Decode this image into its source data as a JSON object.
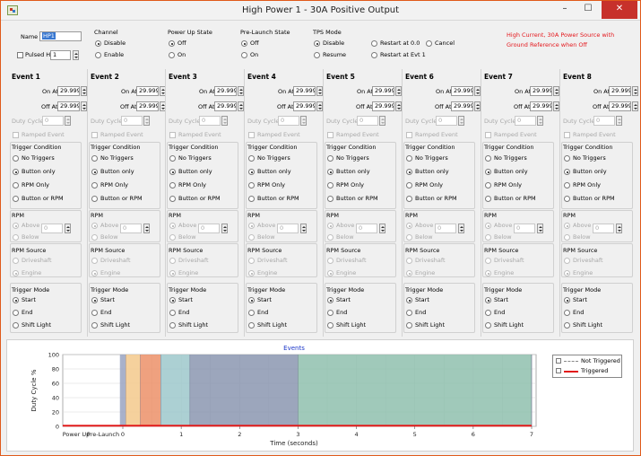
{
  "window": {
    "title": "High Power 1 - 30A Positive Output",
    "minimize": "–",
    "maximize": "☐",
    "close": "✕"
  },
  "header": {
    "name_label": "Name",
    "name_value": "HP1",
    "pulsed_label": "Pulsed Hz",
    "pulsed_value": "1",
    "channel": {
      "title": "Channel",
      "options": [
        "Disable",
        "Enable"
      ],
      "selected": "Disable"
    },
    "power_up": {
      "title": "Power Up State",
      "options": [
        "Off",
        "On"
      ],
      "selected": "Off"
    },
    "pre_launch": {
      "title": "Pre-Launch State",
      "options": [
        "Off",
        "On"
      ],
      "selected": "Off"
    },
    "tps": {
      "title": "TPS Mode",
      "options": [
        "Disable",
        "Restart at 0.0",
        "Cancel",
        "Resume",
        "Restart at Evt 1"
      ],
      "selected": "Disable"
    },
    "warning": "High Current, 30A Power Source with Ground Reference when Off"
  },
  "event_labels": {
    "on_at": "On At",
    "off_at": "Off At",
    "duty_cycle": "Duty Cycle",
    "ramped": "Ramped Event",
    "trigger_condition": "Trigger Condition",
    "trigger_options": [
      "No Triggers",
      "Button only",
      "RPM Only",
      "Button or RPM"
    ],
    "rpm": "RPM",
    "rpm_options": [
      "Above",
      "Below"
    ],
    "rpm_source": "RPM Source",
    "rpm_source_options": [
      "Driveshaft",
      "Engine"
    ],
    "trigger_mode": "Trigger Mode",
    "trigger_mode_options": [
      "Start",
      "End",
      "Shift Light"
    ]
  },
  "events": [
    {
      "title": "Event 1",
      "on_at": "29.999",
      "off_at": "29.999",
      "duty_cycle": "0",
      "rpm": "0",
      "trigger": "Button only",
      "rpm_level": "Above",
      "rpm_source": "Engine",
      "mode": "Start"
    },
    {
      "title": "Event 2",
      "on_at": "29.999",
      "off_at": "29.999",
      "duty_cycle": "0",
      "rpm": "0",
      "trigger": "Button only",
      "rpm_level": "Above",
      "rpm_source": "Engine",
      "mode": "Start"
    },
    {
      "title": "Event 3",
      "on_at": "29.999",
      "off_at": "29.999",
      "duty_cycle": "0",
      "rpm": "0",
      "trigger": "Button only",
      "rpm_level": "Above",
      "rpm_source": "Engine",
      "mode": "Start"
    },
    {
      "title": "Event 4",
      "on_at": "29.999",
      "off_at": "29.999",
      "duty_cycle": "0",
      "rpm": "0",
      "trigger": "Button only",
      "rpm_level": "Above",
      "rpm_source": "Engine",
      "mode": "Start"
    },
    {
      "title": "Event 5",
      "on_at": "29.999",
      "off_at": "29.999",
      "duty_cycle": "0",
      "rpm": "0",
      "trigger": "Button only",
      "rpm_level": "Above",
      "rpm_source": "Engine",
      "mode": "Start"
    },
    {
      "title": "Event 6",
      "on_at": "29.999",
      "off_at": "29.999",
      "duty_cycle": "0",
      "rpm": "0",
      "trigger": "Button only",
      "rpm_level": "Above",
      "rpm_source": "Engine",
      "mode": "Start"
    },
    {
      "title": "Event 7",
      "on_at": "29.999",
      "off_at": "29.999",
      "duty_cycle": "0",
      "rpm": "0",
      "trigger": "Button only",
      "rpm_level": "Above",
      "rpm_source": "Engine",
      "mode": "Start"
    },
    {
      "title": "Event 8",
      "on_at": "29.999",
      "off_at": "29.999",
      "duty_cycle": "0",
      "rpm": "0",
      "trigger": "Button only",
      "rpm_level": "Above",
      "rpm_source": "Engine",
      "mode": "Start"
    }
  ],
  "chart_data": {
    "type": "area",
    "title": "Events",
    "xlabel": "Time (seconds)",
    "ylabel": "Duty Cycle %",
    "xlim": [
      0,
      7
    ],
    "ylim": [
      0,
      100
    ],
    "x_ticks": [
      "0",
      "1",
      "2",
      "3",
      "4",
      "5",
      "6",
      "7"
    ],
    "y_ticks": [
      "0",
      "20",
      "40",
      "60",
      "80",
      "100"
    ],
    "extra_x_labels": [
      "Power Up",
      "Pre-Launch"
    ],
    "grid": true,
    "legend_position": "top-right",
    "bands": [
      {
        "start": -0.05,
        "end": 0.05,
        "color": "#9aa4c2"
      },
      {
        "start": 0.05,
        "end": 0.3,
        "color": "#f3c98c"
      },
      {
        "start": 0.3,
        "end": 0.65,
        "color": "#ec9169"
      },
      {
        "start": 0.65,
        "end": 1.15,
        "color": "#9dc8cb"
      },
      {
        "start": 1.15,
        "end": 3.0,
        "color": "#8b97b0"
      },
      {
        "start": 3.0,
        "end": 7.0,
        "color": "#8fbfae"
      }
    ],
    "series": [
      {
        "name": "Not Triggered",
        "color": "#888888",
        "values": [
          [
            -1.2,
            1
          ],
          [
            7,
            1
          ]
        ]
      },
      {
        "name": "Triggered",
        "color": "#e21b1b",
        "values": [
          [
            -1.2,
            1
          ],
          [
            7,
            1
          ]
        ]
      }
    ]
  },
  "colors": {
    "accent": "#3877d0",
    "warning": "#e4161b",
    "close": "#c7312b"
  }
}
